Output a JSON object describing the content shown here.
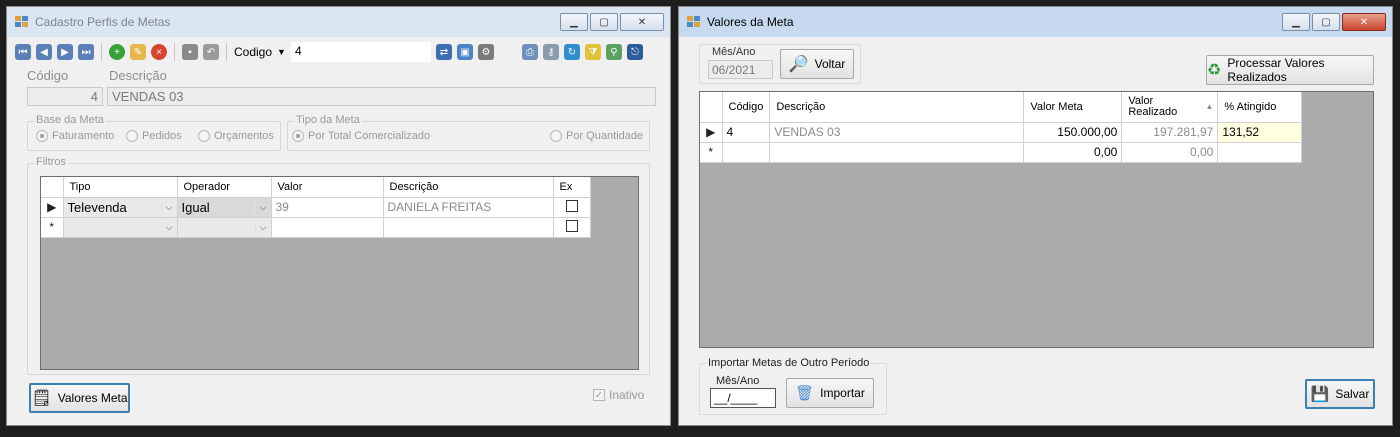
{
  "left_window": {
    "title": "Cadastro Perfis de Metas",
    "toolbar": {
      "search_field_label": "Codigo",
      "search_value": "4",
      "icons": [
        "first-icon",
        "prev-icon",
        "next-icon",
        "last-icon",
        "add-icon",
        "edit-icon",
        "delete-icon",
        "save-icon",
        "undo-icon",
        "search-icon",
        "image-icon",
        "tools-icon",
        "print-icon",
        "key-icon",
        "refresh-icon",
        "filter-icon",
        "pin-icon",
        "exit-icon"
      ]
    },
    "codigo_label": "Código",
    "codigo_value": "4",
    "descricao_label": "Descrição",
    "descricao_value": "VENDAS 03",
    "base_meta": {
      "title": "Base da Meta",
      "options": [
        "Faturamento",
        "Pedidos",
        "Orçamentos"
      ]
    },
    "tipo_meta": {
      "title": "Tipo da Meta",
      "options": [
        "Por Total Comercializado",
        "Por Quantidade"
      ]
    },
    "filtros": {
      "title": "Filtros",
      "columns": [
        "Tipo",
        "Operador",
        "Valor",
        "Descrição",
        "Ex"
      ],
      "rows": [
        {
          "tipo": "Televenda",
          "operador": "Igual",
          "valor": "39",
          "descricao": "DANIELA  FREITAS",
          "ex": false
        }
      ]
    },
    "valores_meta_button": "Valores Meta",
    "inativo_label": "Inativo"
  },
  "right_window": {
    "title": "Valores da Meta",
    "mes_ano_label": "Mês/Ano",
    "mes_ano_value": "06/2021",
    "voltar_button": "Voltar",
    "processar_button": "Processar Valores Realizados",
    "grid": {
      "columns": [
        "Código",
        "Descrição",
        "Valor Meta",
        "Valor\nRealizado",
        "% Atingido"
      ],
      "rows": [
        {
          "codigo": "4",
          "descricao": "VENDAS 03",
          "valor_meta": "150.000,00",
          "valor_realizado": "197.281,97",
          "atingido": "131,52"
        }
      ],
      "new_row": {
        "valor_meta": "0,00",
        "valor_realizado": "0,00"
      }
    },
    "importar": {
      "title": "Importar Metas de Outro Período",
      "mes_ano_label": "Mês/Ano",
      "mes_ano_mask": "__/____",
      "importar_button": "Importar"
    },
    "salvar_button": "Salvar"
  }
}
